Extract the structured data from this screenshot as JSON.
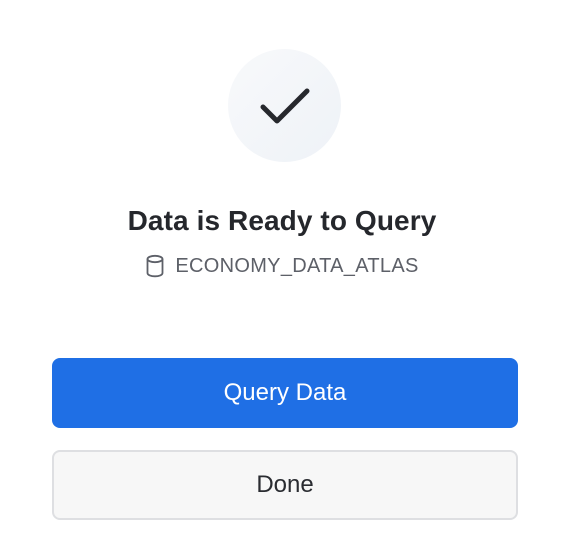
{
  "status_icon": "checkmark-icon",
  "title": "Data is Ready to Query",
  "database": {
    "icon": "database-icon",
    "name": "ECONOMY_DATA_ATLAS"
  },
  "buttons": {
    "primary_label": "Query Data",
    "secondary_label": "Done"
  },
  "colors": {
    "primary": "#1f6fe5",
    "title": "#25272c",
    "muted": "#5d6068"
  }
}
